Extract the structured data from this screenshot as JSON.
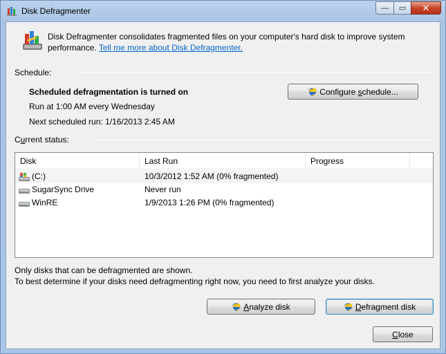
{
  "window": {
    "title": "Disk Defragmenter",
    "minimize_label": "—",
    "maximize_label": "▭",
    "close_label": "✕"
  },
  "intro": {
    "text": "Disk Defragmenter consolidates fragmented files on your computer's hard disk to improve system performance. ",
    "link": "Tell me more about Disk Defragmenter."
  },
  "schedule": {
    "label": "Schedule:",
    "status": "Scheduled defragmentation is turned on",
    "run_at": "Run at 1:00 AM every Wednesday",
    "next_run": "Next scheduled run: 1/16/2013 2:45 AM",
    "configure_button": {
      "pre": "Configure ",
      "u": "s",
      "post": "chedule..."
    }
  },
  "status": {
    "label_pre": "C",
    "label_u": "u",
    "label_post": "rrent status:",
    "columns": [
      "Disk",
      "Last Run",
      "Progress"
    ],
    "rows": [
      {
        "disk": "(C:)",
        "last_run": "10/3/2012 1:52 AM (0% fragmented)",
        "progress": "",
        "icon": "system-drive-icon"
      },
      {
        "disk": "SugarSync Drive",
        "last_run": "Never run",
        "progress": "",
        "icon": "drive-icon"
      },
      {
        "disk": "WinRE",
        "last_run": "1/9/2013 1:26 PM (0% fragmented)",
        "progress": "",
        "icon": "drive-icon"
      }
    ]
  },
  "notes": {
    "line1": "Only disks that can be defragmented are shown.",
    "line2": "To best determine if your disks need defragmenting right now, you need to first analyze your disks."
  },
  "buttons": {
    "analyze": {
      "u": "A",
      "post": "nalyze disk"
    },
    "defrag": {
      "u": "D",
      "post": "efragment disk"
    },
    "close": {
      "u": "C",
      "post": "lose"
    }
  },
  "colors": {
    "link": "#0066cc",
    "accent": "#3c7fb1"
  }
}
